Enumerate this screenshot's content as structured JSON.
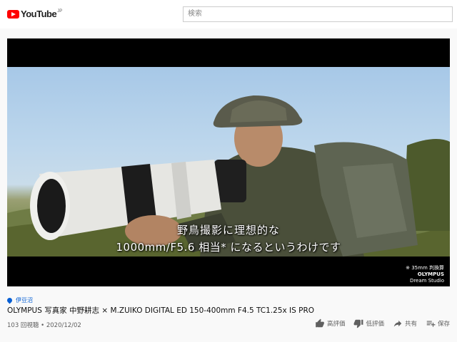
{
  "header": {
    "logo_text": "YouTube",
    "logo_region": "JP",
    "search_placeholder": "検索"
  },
  "video": {
    "subtitle_line1": "野鳥撮影に理想的な",
    "subtitle_line2": "1000mm/F5.6 相当* になるというわけです",
    "watermark_line1": "※ 35mm 判換算",
    "watermark_line2": "OLYMPUS",
    "watermark_line3": "Dream Studio"
  },
  "info": {
    "location": "伊豆沼",
    "title": "OLYMPUS 写真家 中野耕志 × M.ZUIKO DIGITAL ED 150-400mm F4.5 TC1.25x IS PRO",
    "views_date": "103 回視聴 • 2020/12/02"
  },
  "actions": {
    "like": "高評価",
    "dislike": "低評価",
    "share": "共有",
    "save": "保存"
  },
  "colors": {
    "brand_red": "#ff0000",
    "link_blue": "#065fd4",
    "text": "#0f0f0f",
    "meta": "#606060"
  }
}
